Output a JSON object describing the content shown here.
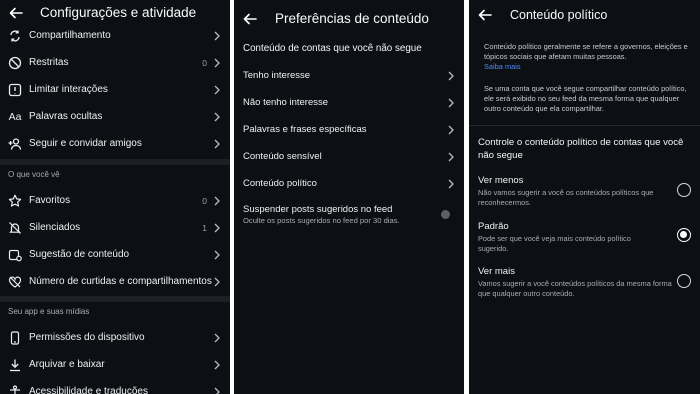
{
  "panel1": {
    "title": "Configurações e atividade",
    "items_top": [
      {
        "label": "Compartilhamento",
        "icon": "share-icon",
        "count": ""
      },
      {
        "label": "Restritas",
        "icon": "restricted-icon",
        "count": "0"
      },
      {
        "label": "Limitar interações",
        "icon": "limit-interactions-icon",
        "count": ""
      },
      {
        "label": "Palavras ocultas",
        "icon": "hidden-words-icon",
        "count": ""
      },
      {
        "label": "Seguir e convidar amigos",
        "icon": "add-person-icon",
        "count": ""
      }
    ],
    "section_what_you_see": "O que você vê",
    "items_see": [
      {
        "label": "Favoritos",
        "icon": "star-icon",
        "count": "0"
      },
      {
        "label": "Silenciados",
        "icon": "muted-bell-icon",
        "count": "1"
      },
      {
        "label": "Sugestão de conteúdo",
        "icon": "suggested-content-icon",
        "count": ""
      },
      {
        "label": "Número de curtidas e compartilhamentos",
        "icon": "heart-icon",
        "count": ""
      }
    ],
    "section_app_media": "Seu app e suas mídias",
    "items_app": [
      {
        "label": "Permissões do dispositivo",
        "icon": "phone-icon",
        "count": ""
      },
      {
        "label": "Arquivar e baixar",
        "icon": "download-icon",
        "count": ""
      },
      {
        "label": "Acessibilidade e traduções",
        "icon": "accessibility-icon",
        "count": ""
      }
    ]
  },
  "panel2": {
    "title": "Preferências de conteúdo",
    "section_title": "Conteúdo de contas que você não segue",
    "items": [
      {
        "label": "Tenho interesse"
      },
      {
        "label": "Não tenho interesse"
      },
      {
        "label": "Palavras e frases específicas"
      },
      {
        "label": "Conteúdo sensível"
      },
      {
        "label": "Conteúdo político"
      }
    ],
    "suspend_title": "Suspender posts sugeridos no feed",
    "suspend_desc": "Oculte os posts sugeridos no feed por 30 dias."
  },
  "panel3": {
    "title": "Conteúdo político",
    "intro": "Conteúdo político geralmente se refere a governos, eleições e tópicos sociais que afetam muitas pessoas.",
    "learn_more": "Saiba mais",
    "intro2": "Se uma conta que você segue compartilhar conteúdo político, ele será exibido no seu feed da mesma forma que qualquer outro conteúdo que ela compartilhar.",
    "control_title": "Controle o conteúdo político de contas que você não segue",
    "options": [
      {
        "label": "Ver menos",
        "desc": "Não vamos sugerir a você os conteúdos políticos que reconhecermos.",
        "selected": false
      },
      {
        "label": "Padrão",
        "desc": "Pode ser que você veja mais conteúdo político sugerido.",
        "selected": true
      },
      {
        "label": "Ver mais",
        "desc": "Vamos sugerir a você conteúdos políticos da mesma forma que qualquer outro conteúdo.",
        "selected": false
      }
    ]
  }
}
